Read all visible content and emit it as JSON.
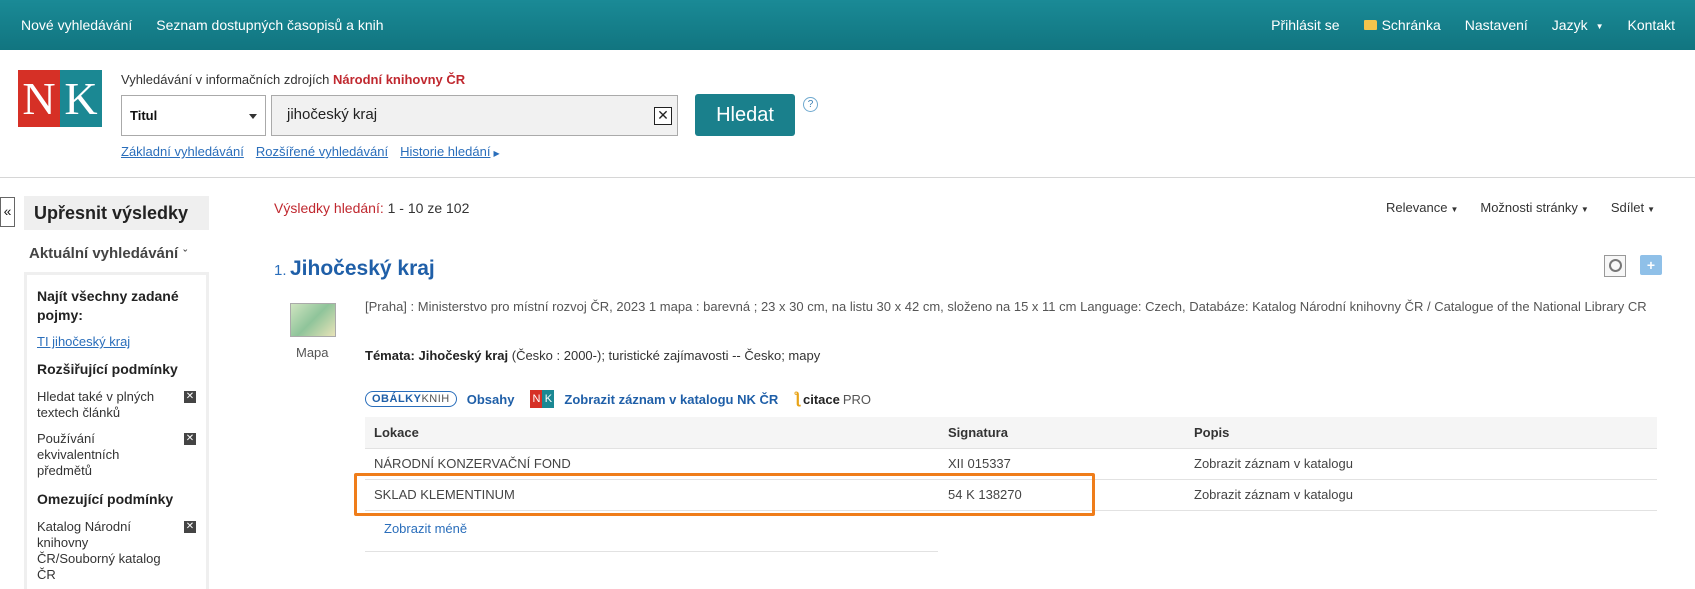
{
  "nav": {
    "left": [
      "Nové vyhledávání",
      "Seznam dostupných časopisů a knih"
    ],
    "login": "Přihlásit se",
    "clipboard": "Schránka",
    "settings": "Nastavení",
    "language": "Jazyk",
    "contact": "Kontakt"
  },
  "logo": {
    "n": "N",
    "k": "K"
  },
  "search": {
    "intro_prefix": "Vyhledávání v informačních zdrojích",
    "intro_library": "Národní knihovny ČR",
    "field_type": "Titul",
    "query": "jihočeský kraj",
    "clear_symbol": "✕",
    "button": "Hledat",
    "help": "?",
    "links": [
      "Základní vyhledávání",
      "Rozšířené vyhledávání",
      "Historie hledání"
    ]
  },
  "sidebar": {
    "collapse": "«",
    "title": "Upřesnit výsledky",
    "current_search": "Aktuální vyhledávání",
    "find_all_heading": "Najít všechny zadané pojmy:",
    "term": "TI jihočeský kraj",
    "expanding_heading": "Rozšiřující podmínky",
    "expanding": [
      "Hledat také v plných textech článků",
      "Používání ekvivalentních předmětů"
    ],
    "limiting_heading": "Omezující podmínky",
    "limiting": [
      "Katalog Národní knihovny ČR/Souborný katalog ČR"
    ]
  },
  "results": {
    "label": "Výsledky hledání:",
    "range": "1 - 10 ze 102",
    "toolbar": [
      "Relevance",
      "Možnosti stránky",
      "Sdílet"
    ]
  },
  "record": {
    "number": "1.",
    "title": "Jihočeský kraj",
    "type_label": "Mapa",
    "description": "[Praha] : Ministerstvo pro místní rozvoj ČR, 2023 1 mapa : barevná ; 23 x 30 cm, na listu 30 x 42 cm, složeno na 15 x 11 cm Language: Czech, Databáze: Katalog Národní knihovny ČR / Catalogue of the National Library CR",
    "topics_label": "Témata:",
    "topics_main": "Jihočeský kraj",
    "topics_rest": "(Česko : 2000-); turistické zajímavosti -- Česko; mapy",
    "links": {
      "obalky_a": "OBÁLKY",
      "obalky_b": "KNIH",
      "contents": "Obsahy",
      "catalog": "Zobrazit záznam v katalogu NK ČR",
      "citace": "citace",
      "pro": "PRO"
    },
    "holdings": {
      "headers": [
        "Lokace",
        "Signatura",
        "Popis"
      ],
      "rows": [
        [
          "NÁRODNÍ KONZERVAČNÍ FOND",
          "XII 015337",
          "Zobrazit záznam v katalogu"
        ],
        [
          "SKLAD KLEMENTINUM",
          "54 K 138270",
          "Zobrazit záznam v katalogu"
        ]
      ]
    },
    "show_less": "Zobrazit méně"
  },
  "colors": {
    "nav": "#1a8a96",
    "accent_red": "#c0282f",
    "highlight": "#ef7d1a",
    "link": "#2a6ebb"
  }
}
